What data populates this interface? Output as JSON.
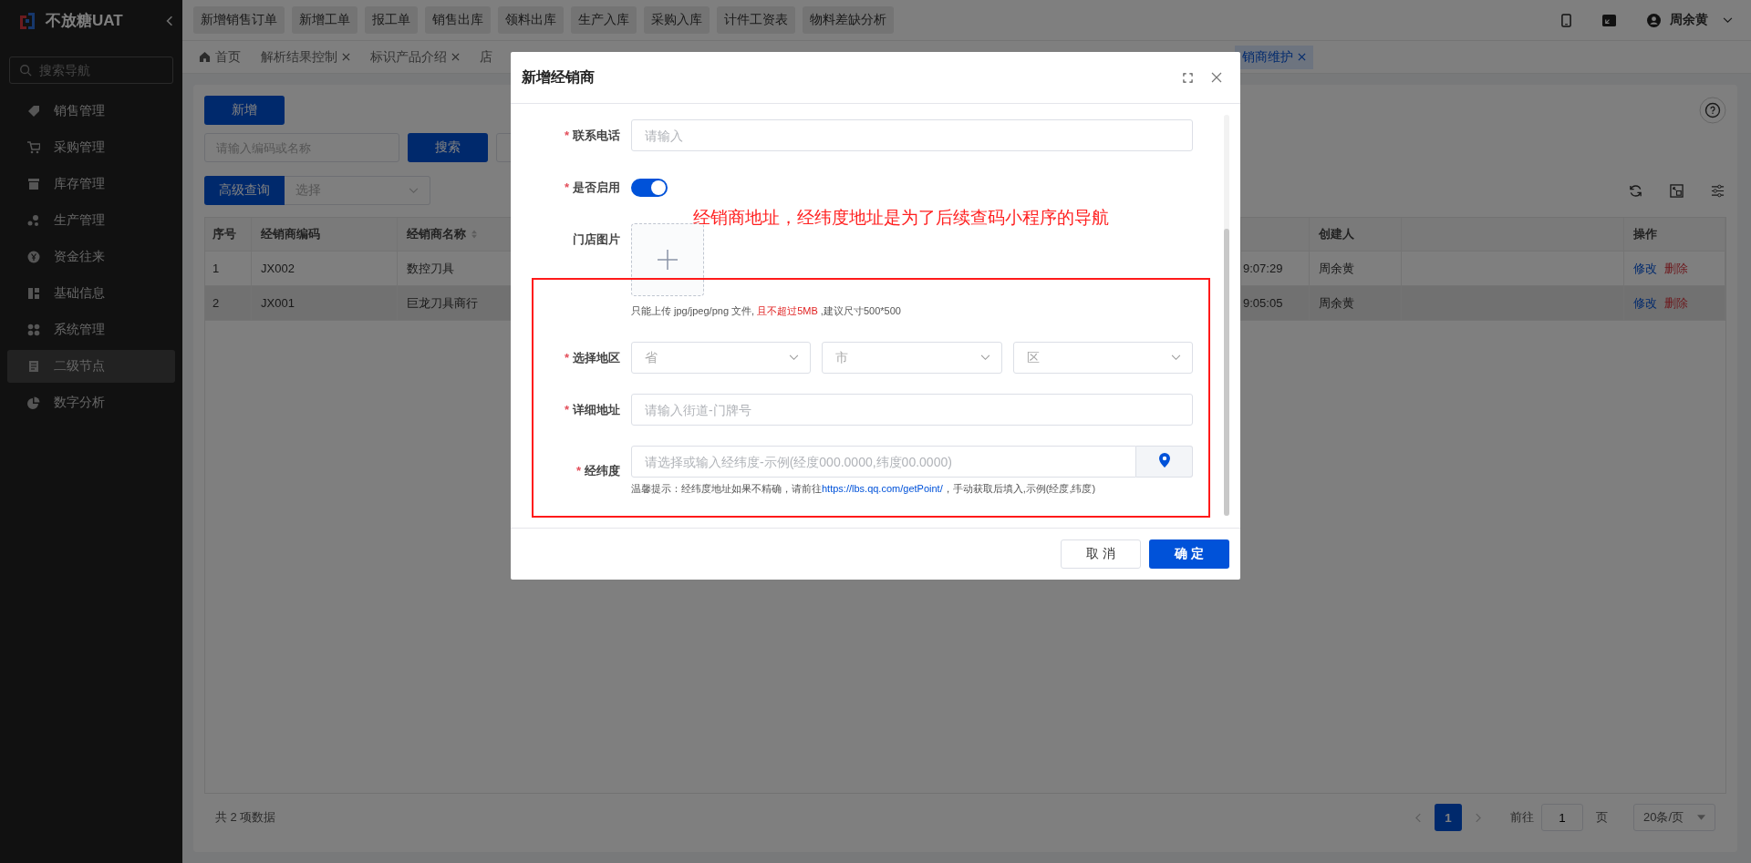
{
  "app": {
    "logo_text": "不放糖UAT",
    "search_placeholder": "搜索导航"
  },
  "sidebar": {
    "items": [
      {
        "label": "销售管理",
        "selected": false
      },
      {
        "label": "采购管理",
        "selected": false
      },
      {
        "label": "库存管理",
        "selected": false
      },
      {
        "label": "生产管理",
        "selected": false
      },
      {
        "label": "资金往来",
        "selected": false
      },
      {
        "label": "基础信息",
        "selected": false
      },
      {
        "label": "系统管理",
        "selected": false
      },
      {
        "label": "二级节点",
        "selected": true
      },
      {
        "label": "数字分析",
        "selected": false
      }
    ]
  },
  "shortcuts": [
    "新增销售订单",
    "新增工单",
    "报工单",
    "销售出库",
    "领料出库",
    "生产入库",
    "采购入库",
    "计件工资表",
    "物料差缺分析"
  ],
  "header": {
    "user": "周余黄"
  },
  "tabs": [
    {
      "label": "首页",
      "kind": "home",
      "selected": false
    },
    {
      "label": "解析结果控制",
      "kind": "closable",
      "selected": false
    },
    {
      "label": "标识产品介绍",
      "kind": "closable",
      "selected": false
    },
    {
      "label": "店",
      "kind": "plain",
      "selected": false
    },
    {
      "label": "销商维护",
      "kind": "closable",
      "selected": true
    }
  ],
  "toolbar": {
    "add": "新增",
    "search_placeholder": "请输入编码或名称",
    "search": "搜索",
    "advanced": "高级查询",
    "select_placeholder": "选择"
  },
  "table": {
    "columns": [
      {
        "label": "序号",
        "sortable": false
      },
      {
        "label": "经销商编码",
        "sortable": false
      },
      {
        "label": "经销商名称",
        "sortable": true
      },
      {
        "label": "创建人",
        "sortable": false
      },
      {
        "label": "操作",
        "sortable": false
      }
    ],
    "rows": [
      {
        "index": "1",
        "code": "JX002",
        "name": "数控刀具",
        "time": "9:07:29",
        "creator": "周余黄",
        "actions": [
          "修改",
          "删除"
        ],
        "highlighted": false
      },
      {
        "index": "2",
        "code": "JX001",
        "name": "巨龙刀具商行",
        "time": "9:05:05",
        "creator": "周余黄",
        "actions": [
          "修改",
          "删除"
        ],
        "highlighted": true
      }
    ]
  },
  "pagination": {
    "total": "共 2 项数据",
    "pages": [
      {
        "label": "1",
        "selected": true
      }
    ],
    "goto": "前往",
    "page_value": "1",
    "page_unit": "页",
    "page_size": "20条/页"
  },
  "dialog": {
    "title": "新增经销商",
    "annotation": "经销商地址，经纬度地址是为了后续查码小程序的导航",
    "fields": [
      {
        "kind": "input",
        "label": "联系电话",
        "required_mark": "*",
        "placeholder": "请输入"
      },
      {
        "kind": "switch",
        "label": "是否启用",
        "required_mark": "*",
        "on": true
      },
      {
        "kind": "upload",
        "label": "门店图片",
        "hint_parts": [
          {
            "text": "只能上传 jpg/jpeg/png 文件, ",
            "emphasis": false
          },
          {
            "text": "且不超过5MB",
            "emphasis": true
          },
          {
            "text": " ,建议尺寸500*500",
            "emphasis": false
          }
        ]
      },
      {
        "kind": "region",
        "label": "选择地区",
        "required_mark": "*",
        "selects": [
          "省",
          "市",
          "区"
        ]
      },
      {
        "kind": "input",
        "label": "详细地址",
        "required_mark": "*",
        "placeholder": "请输入街道-门牌号"
      },
      {
        "kind": "coordinate",
        "label": "经纬度",
        "required_mark": "*",
        "placeholder": "请选择或输入经纬度-示例(经度000.0000,纬度00.0000)",
        "hint_before": "温馨提示：经纬度地址如果不精确，请前往",
        "link": "https://lbs.qq.com/getPoint/",
        "hint_after": "，手动获取后填入,示例(经度,纬度)"
      }
    ],
    "buttons": [
      {
        "label": "取 消",
        "kind": "secondary"
      },
      {
        "label": "确 定",
        "kind": "primary"
      }
    ]
  }
}
